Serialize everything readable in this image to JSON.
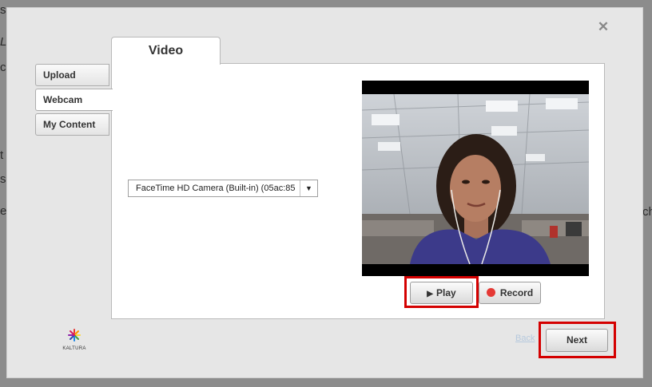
{
  "dialog": {
    "close_icon": "close-icon",
    "tabs": [
      {
        "label": "Upload"
      },
      {
        "label": "Webcam"
      },
      {
        "label": "My Content"
      }
    ],
    "active_tab": "Webcam",
    "panel_title": "Video",
    "camera_select": {
      "value": "FaceTime HD Camera (Built-in) (05ac:85",
      "arrow_icon": "dropdown-arrow-icon"
    },
    "controls": {
      "play_label": "Play",
      "record_label": "Record",
      "record_color": "#e53935"
    },
    "footer": {
      "back_label": "Back",
      "next_label": "Next",
      "logo_text": "KALTURA"
    },
    "highlight_color": "#d40000"
  },
  "background": {
    "fragments": [
      "s",
      "L",
      "c",
      "t",
      "s",
      "e",
      "ch"
    ]
  }
}
